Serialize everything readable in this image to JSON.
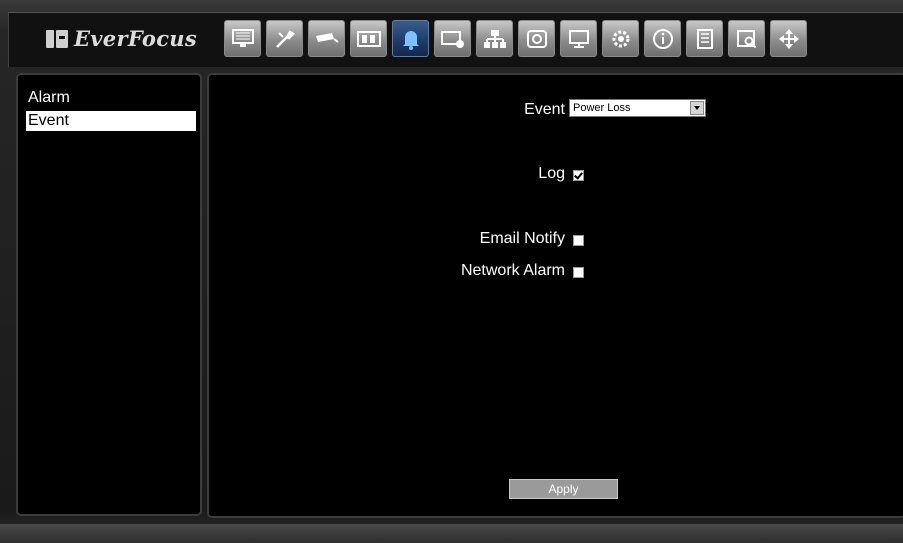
{
  "brand": {
    "name": "EverFocus"
  },
  "toolbar": {
    "icons": [
      "monitor-icon",
      "tools-icon",
      "camera-icon",
      "film-icon",
      "alarm-bell-icon",
      "recorder-timer-icon",
      "network-icon",
      "disk-icon",
      "display-icon",
      "gear-icon",
      "info-icon",
      "playback-icon",
      "search-icon",
      "ptz-move-icon"
    ],
    "active": "alarm-bell-icon"
  },
  "sidebar": {
    "items": [
      {
        "label": "Alarm"
      },
      {
        "label": "Event"
      }
    ],
    "selected": "Event"
  },
  "form": {
    "event_label": "Event",
    "event_value": "Power Loss",
    "log_label": "Log",
    "log_checked": true,
    "email_label": "Email Notify",
    "email_checked": false,
    "network_label": "Network Alarm",
    "network_checked": false,
    "apply_label": "Apply"
  },
  "colors": {
    "active_button": "#1c3a66",
    "panel_bg": "#000000",
    "panel_border": "#3c3c3c"
  }
}
